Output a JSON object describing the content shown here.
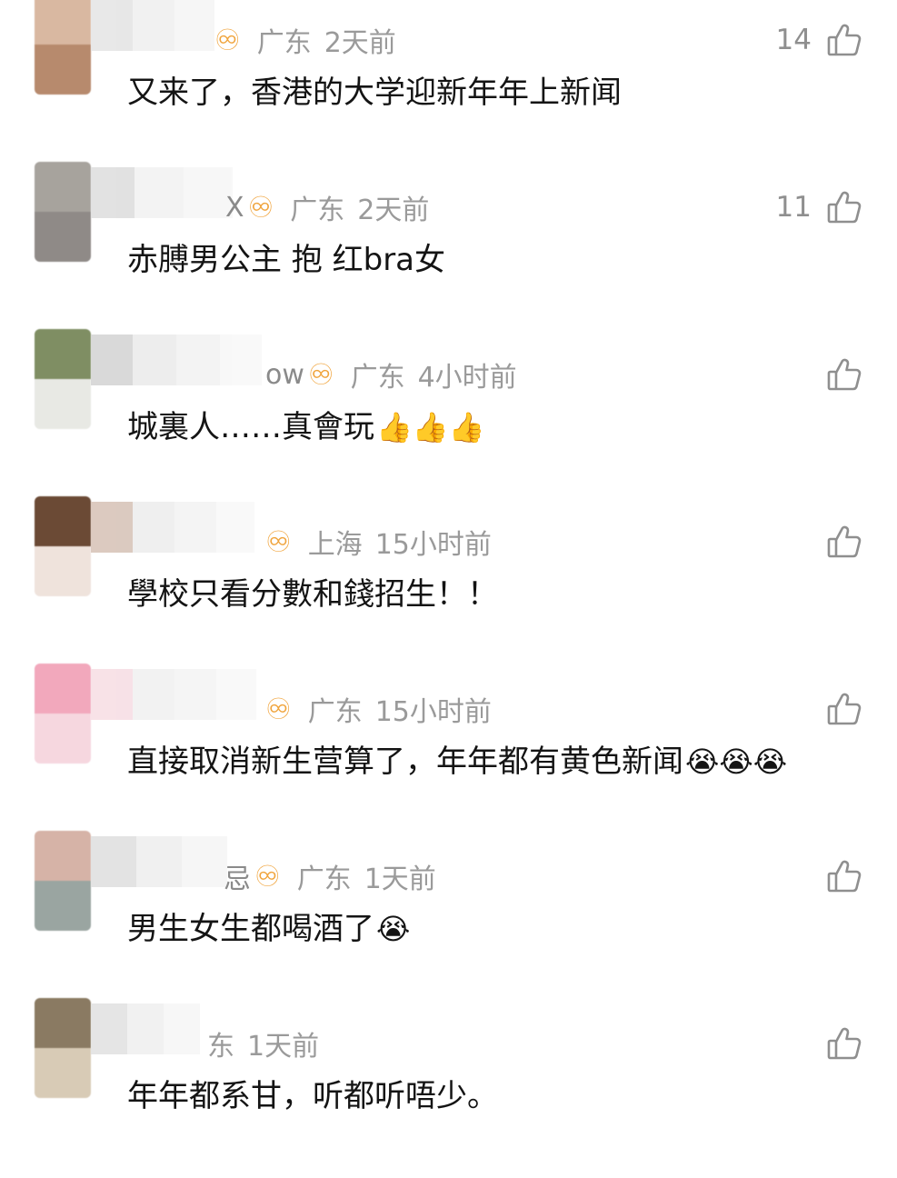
{
  "comments": [
    {
      "name_tail": "",
      "location": "广东",
      "time": "2天前",
      "likes": "14",
      "text": "又来了，香港的大学迎新年年上新闻",
      "emoji": ""
    },
    {
      "name_tail": "X",
      "location": "广东",
      "time": "2天前",
      "likes": "11",
      "text": "赤膊男公主  抱  红bra女",
      "emoji": ""
    },
    {
      "name_tail": "ow",
      "location": "广东",
      "time": "4小时前",
      "likes": "",
      "text": "城裏人……真會玩",
      "emoji": "👍👍👍"
    },
    {
      "name_tail": "",
      "location": "上海",
      "time": "15小时前",
      "likes": "",
      "text": "學校只看分數和錢招生！！",
      "emoji": ""
    },
    {
      "name_tail": "",
      "location": "广东",
      "time": "15小时前",
      "likes": "",
      "text": "直接取消新生营算了，年年都有黄色新闻",
      "emoji": "😭😭😭"
    },
    {
      "name_tail": "忌",
      "location": "广东",
      "time": "1天前",
      "likes": "",
      "text": "男生女生都喝酒了",
      "emoji": "😭"
    },
    {
      "name_tail": "",
      "location": "东",
      "time": "1天前",
      "likes": "",
      "text": "年年都系甘，听都听唔少。",
      "emoji": ""
    }
  ],
  "icons": {
    "vip": "vip-badge-icon",
    "like": "thumbs-up-icon"
  },
  "colors": {
    "meta_text": "#9a9a9a",
    "vip_badge": "#f0a33a",
    "body_text": "#141414",
    "like_icon": "#8f8f8f"
  }
}
